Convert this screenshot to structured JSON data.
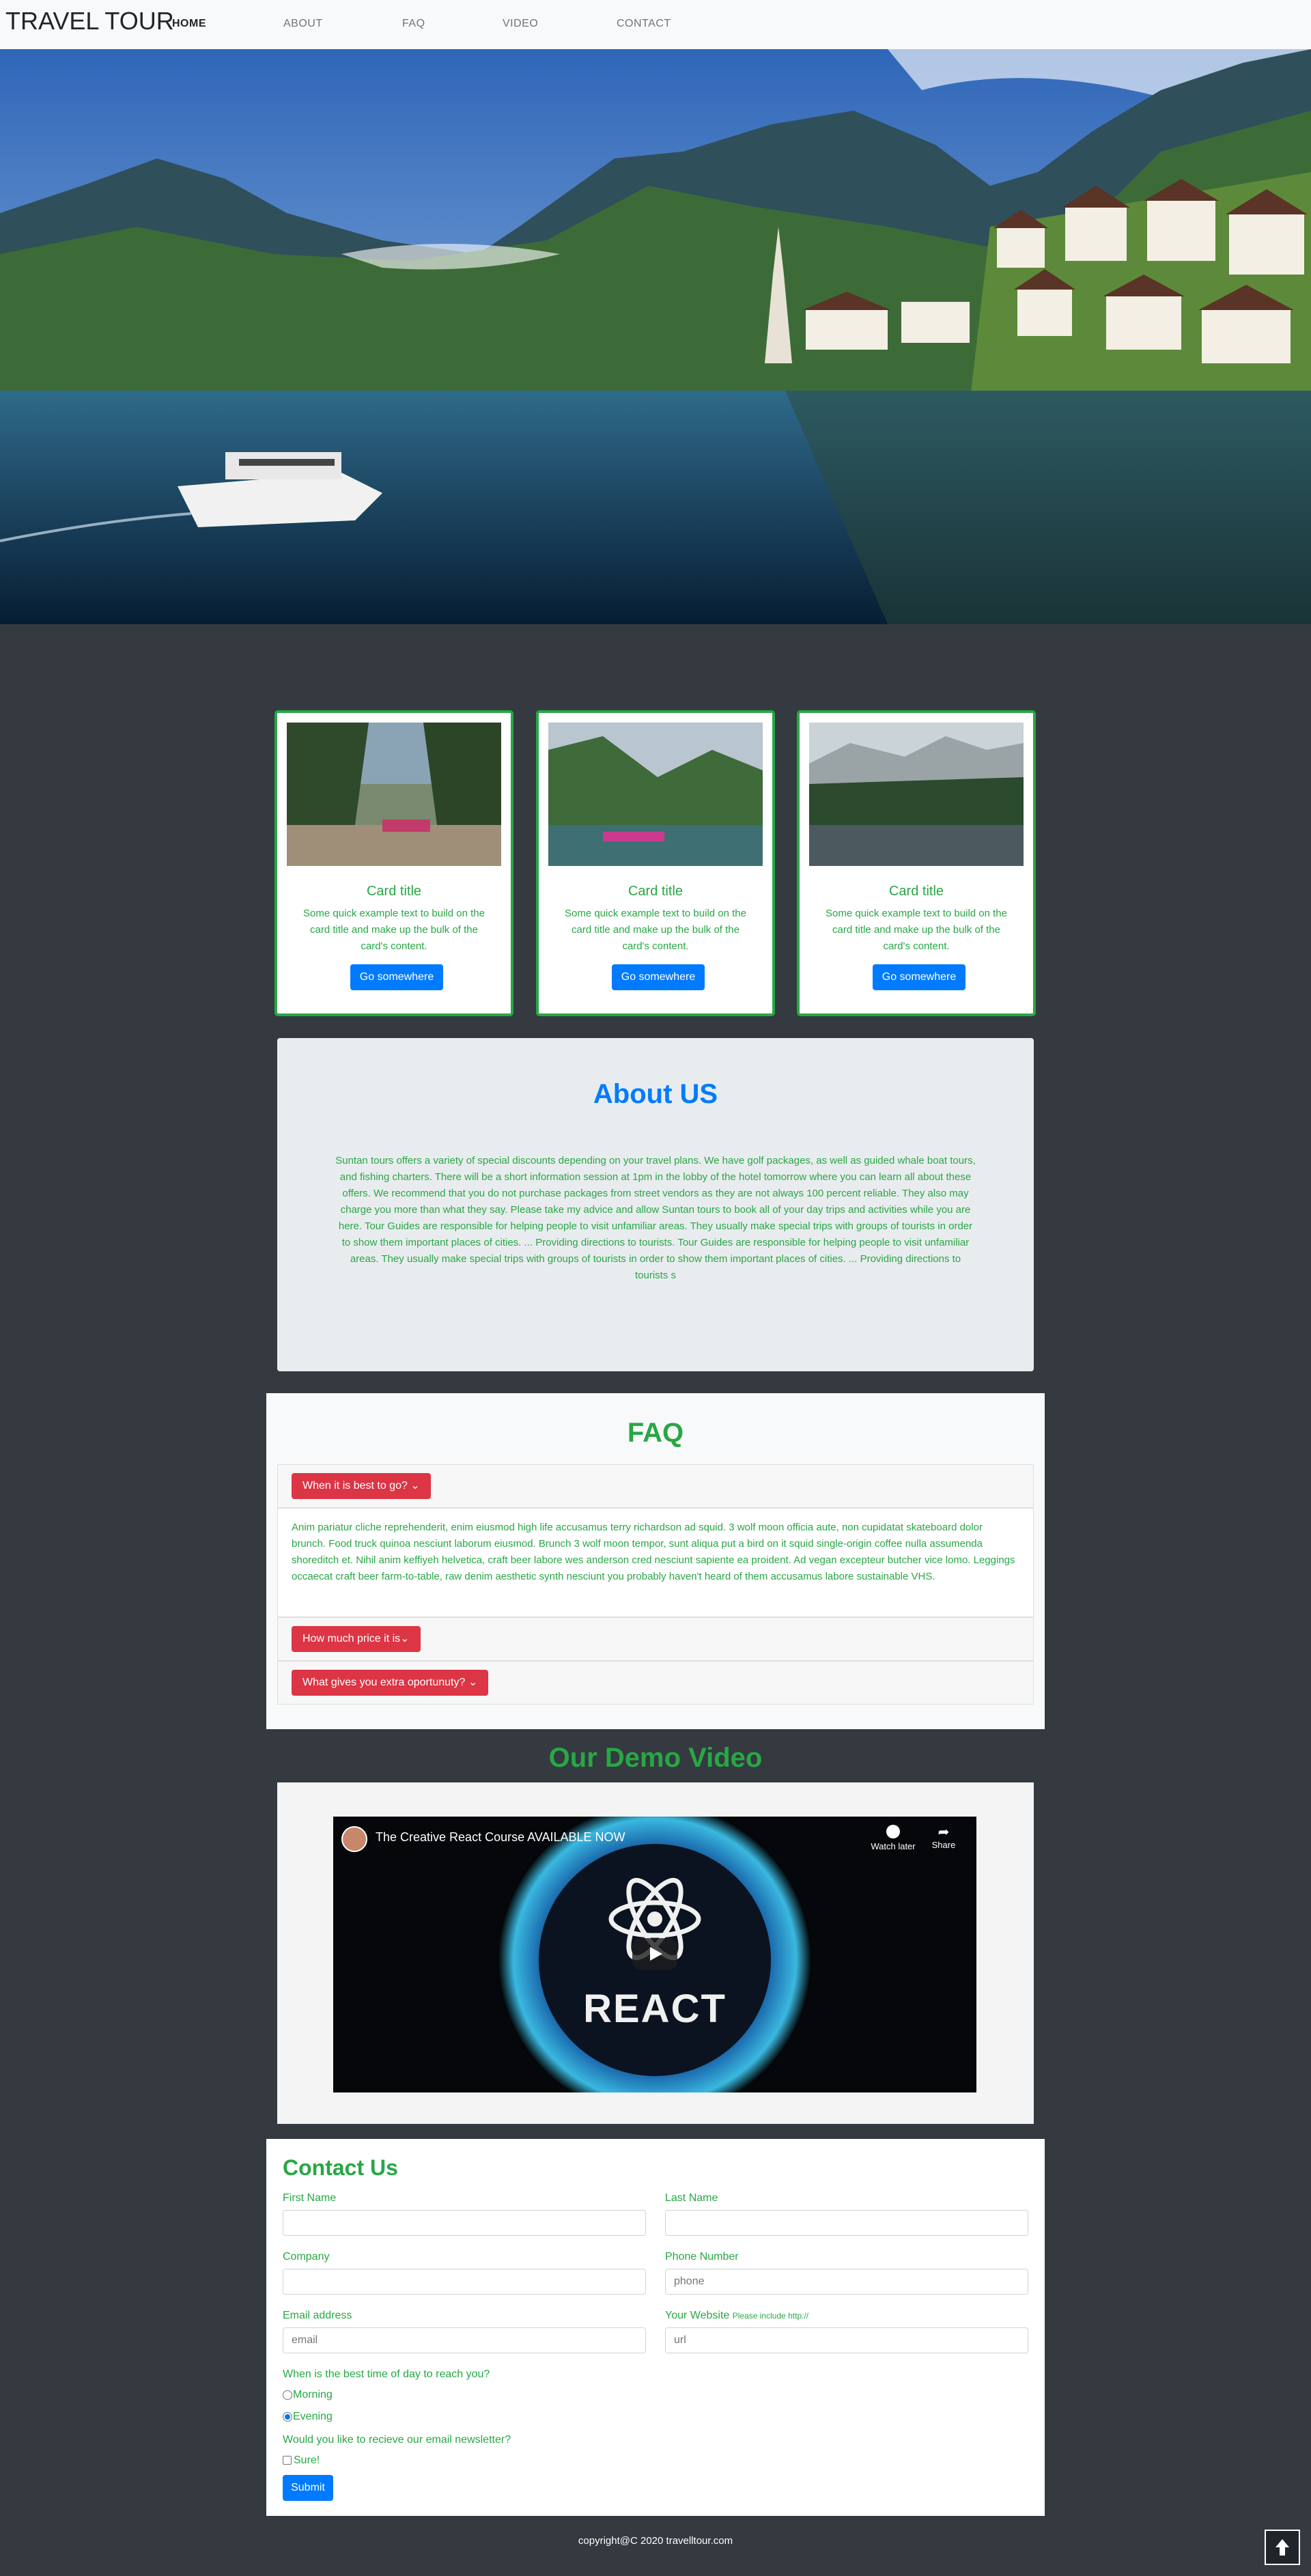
{
  "navbar": {
    "brand": "TRAVEL TOUR",
    "links": [
      "HOME",
      "ABOUT",
      "FAQ",
      "VIDEO",
      "CONTACT"
    ]
  },
  "cards": [
    {
      "title": "Card title",
      "text": "Some quick example text to build on the card title and make up the bulk of the card's content.",
      "button": "Go somewhere"
    },
    {
      "title": "Card title",
      "text": "Some quick example text to build on the card title and make up the bulk of the card's content.",
      "button": "Go somewhere"
    },
    {
      "title": "Card title",
      "text": "Some quick example text to build on the card title and make up the bulk of the card's content.",
      "button": "Go somewhere"
    }
  ],
  "about": {
    "title": "About US",
    "text": "Suntan tours offers a variety of special discounts depending on your travel plans. We have golf packages, as well as guided whale boat tours, and fishing charters. There will be a short information session at 1pm in the lobby of the hotel tomorrow where you can learn all about these offers. We recommend that you do not purchase packages from street vendors as they are not always 100 percent reliable. They also may charge you more than what they say. Please take my advice and allow Suntan tours to book all of your day trips and activities while you are here. Tour Guides are responsible for helping people to visit unfamiliar areas. They usually make special trips with groups of tourists in order to show them important places of cities. ... Providing directions to tourists. Tour Guides are responsible for helping people to visit unfamiliar areas. They usually make special trips with groups of tourists in order to show them important places of cities. ... Providing directions to tourists s"
  },
  "faq": {
    "title": "FAQ",
    "items": [
      {
        "question": "When it is best to go?",
        "answer": "Anim pariatur cliche reprehenderit, enim eiusmod high life accusamus terry richardson ad squid. 3 wolf moon officia aute, non cupidatat skateboard dolor brunch. Food truck quinoa nesciunt laborum eiusmod. Brunch 3 wolf moon tempor, sunt aliqua put a bird on it squid single-origin coffee nulla assumenda shoreditch et. Nihil anim keffiyeh helvetica, craft beer labore wes anderson cred nesciunt sapiente ea proident. Ad vegan excepteur butcher vice lomo. Leggings occaecat craft beer farm-to-table, raw denim aesthetic synth nesciunt you probably haven't heard of them accusamus labore sustainable VHS."
      },
      {
        "question": "How much price it is",
        "answer": ""
      },
      {
        "question": "What gives you extra oportunuty?",
        "answer": ""
      }
    ]
  },
  "video": {
    "section_title": "Our Demo Video",
    "title": "The Creative React Course AVAILABLE NOW",
    "watch_later": "Watch later",
    "share": "Share",
    "logo_text": "REACT"
  },
  "contact": {
    "title": "Contact Us",
    "first_name_label": "First Name",
    "last_name_label": "Last Name",
    "company_label": "Company",
    "phone_label": "Phone Number",
    "phone_placeholder": "phone",
    "email_label": "Email address",
    "email_placeholder": "email",
    "website_label": "Your Website",
    "website_hint": "Please include http://",
    "website_placeholder": "url",
    "time_question": "When is the best time of day to reach you?",
    "time_options": [
      "Morning",
      "Evening"
    ],
    "time_selected": "Evening",
    "newsletter_question": "Would you like to recieve our email newsletter?",
    "newsletter_option": "Sure!",
    "submit": "Submit"
  },
  "footer": {
    "copyright": "copyright@C 2020 travelltour.com"
  },
  "colors": {
    "accent": "#28a745",
    "primary": "#007bff",
    "danger": "#dc3545",
    "background": "#343a40"
  },
  "icons": [
    "chevron-down-icon",
    "clock-icon",
    "share-icon",
    "play-icon",
    "react-logo-icon",
    "arrow-up-icon"
  ]
}
